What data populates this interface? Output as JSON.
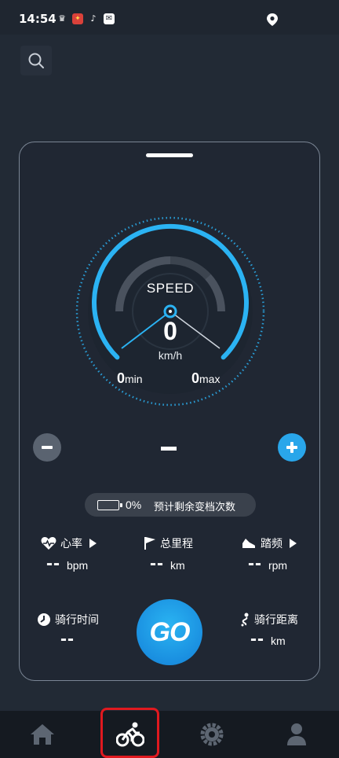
{
  "status_bar": {
    "time": "14:54",
    "icons": [
      "crown-icon",
      "app-icon",
      "tiktok-icon",
      "mail-icon",
      "location-pin-icon"
    ]
  },
  "toolbar": {
    "search_icon": "search-icon"
  },
  "gauge": {
    "title": "SPEED",
    "speed": "0",
    "unit": "km/h",
    "min_value": "0",
    "min_label": "min",
    "max_value": "0",
    "max_label": "max",
    "accent": "#2bb3f3"
  },
  "level": {
    "value": "-",
    "minus_icon": "minus-icon",
    "plus_icon": "plus-icon",
    "plus_color": "#29a6ea"
  },
  "battery": {
    "percent": "0%",
    "label": "预计剩余变档次数"
  },
  "metrics": {
    "heart_rate": {
      "label": "心率",
      "value": "--",
      "unit": "bpm",
      "icon": "heart-rate-icon"
    },
    "total_distance": {
      "label": "总里程",
      "value": "--",
      "unit": "km",
      "icon": "flag-icon"
    },
    "cadence": {
      "label": "踏频",
      "value": "--",
      "unit": "rpm",
      "icon": "shoe-icon"
    },
    "ride_time": {
      "label": "骑行时间",
      "value": "--",
      "icon": "clock-icon"
    },
    "ride_distance": {
      "label": "骑行距离",
      "value": "--",
      "unit": "km",
      "icon": "route-icon"
    }
  },
  "go_button": {
    "label": "GO",
    "color": "#1a8fe0"
  },
  "tabbar": {
    "tabs": [
      "home-icon",
      "bike-icon",
      "settings-icon",
      "profile-icon"
    ],
    "active": "bike-icon",
    "highlight_color": "#e0191f"
  }
}
